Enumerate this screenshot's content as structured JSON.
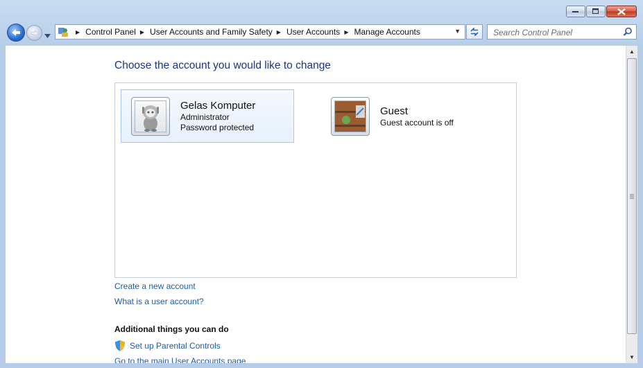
{
  "window": {
    "minimize_icon": "minimize-icon",
    "maximize_icon": "maximize-icon",
    "close_icon": "close-icon"
  },
  "nav": {
    "back_icon": "back-arrow-icon",
    "forward_icon": "forward-arrow-icon",
    "recent_icon": "chevron-down-icon",
    "breadcrumb": [
      "Control Panel",
      "User Accounts and Family Safety",
      "User Accounts",
      "Manage Accounts"
    ],
    "refresh_icon": "refresh-icon",
    "search_placeholder": "Search Control Panel",
    "search_icon": "magnifier-icon"
  },
  "main": {
    "heading": "Choose the account you would like to change",
    "accounts": [
      {
        "name": "Gelas Komputer",
        "line1": "Administrator",
        "line2": "Password protected",
        "selected": true,
        "picture_icon": "robot-avatar-icon"
      },
      {
        "name": "Guest",
        "line1": "Guest account is off",
        "selected": false,
        "picture_icon": "suitcase-avatar-icon"
      }
    ],
    "create_link": "Create a new account",
    "what_link": "What is a user account?",
    "additional_title": "Additional things you can do",
    "parental_link": "Set up Parental Controls",
    "main_page_link": "Go to the main User Accounts page"
  },
  "colors": {
    "link": "#1a5bb5",
    "heading": "#1e3287",
    "selection_border": "#a8c9ea"
  }
}
